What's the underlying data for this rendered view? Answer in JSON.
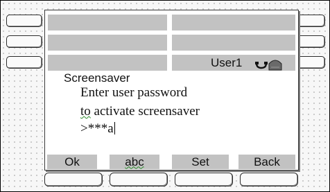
{
  "header": {
    "user_label": "User1"
  },
  "icons": {
    "phone": "handset-icon",
    "envelope": "mailbox-icon"
  },
  "screensaver": {
    "title": "Screensaver",
    "line1": "Enter user password",
    "line2_prefix": "to",
    "line2_rest": " activate screensaver",
    "prompt_prefix": ">",
    "masked": "***",
    "entered_char": "a"
  },
  "softkeys": [
    {
      "label": "Ok"
    },
    {
      "label": "abc"
    },
    {
      "label": "Set"
    },
    {
      "label": "Back"
    }
  ],
  "colors": {
    "bar": "#c2c2c2",
    "screen": "#ffffff",
    "squiggle": "#2a8a2a"
  }
}
